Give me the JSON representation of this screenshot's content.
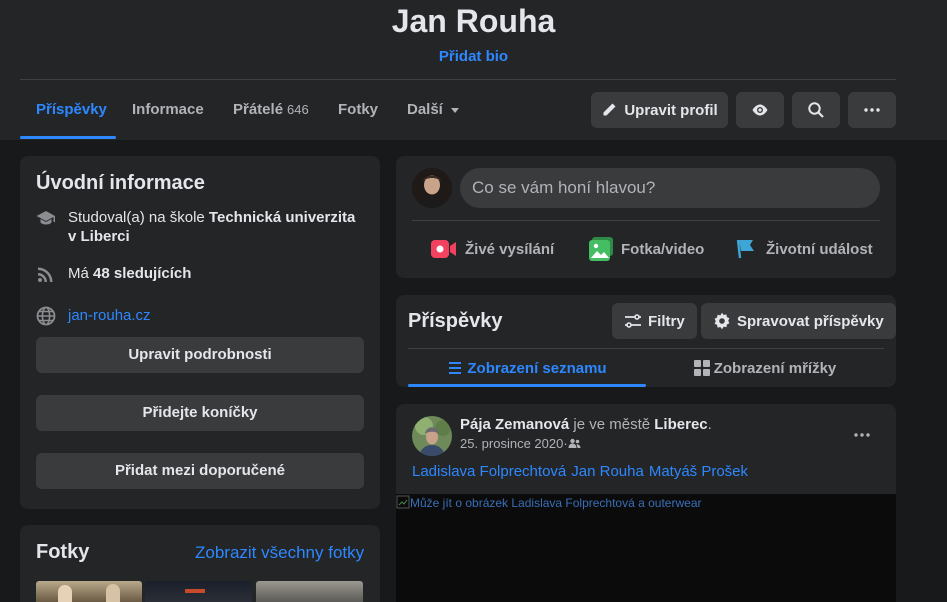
{
  "profile": {
    "name": "Jan Rouha",
    "add_bio": "Přidat bio"
  },
  "tabs": [
    {
      "label": "Příspěvky"
    },
    {
      "label": "Informace"
    },
    {
      "label": "Přátelé",
      "count": "646"
    },
    {
      "label": "Fotky"
    },
    {
      "label": "Další"
    }
  ],
  "header_actions": {
    "edit_profile": "Upravit profil"
  },
  "intro": {
    "title": "Úvodní informace",
    "education_prefix": "Studoval(a) na škole ",
    "education_school": "Technická univerzita v Liberci",
    "followers_prefix": "Má ",
    "followers_value": "48 sledujících",
    "website": "jan-rouha.cz",
    "buttons": [
      "Upravit podrobnosti",
      "Přidejte koníčky",
      "Přidat mezi doporučené"
    ]
  },
  "photos": {
    "title": "Fotky",
    "see_all": "Zobrazit všechny fotky"
  },
  "composer": {
    "placeholder": "Co se vám honí hlavou?",
    "actions": [
      "Živé vysílání",
      "Fotka/video",
      "Životní událost"
    ]
  },
  "posts_section": {
    "title": "Příspěvky",
    "filters": "Filtry",
    "manage": "Spravovat příspěvky",
    "view_list": "Zobrazení seznamu",
    "view_grid": "Zobrazení mřížky"
  },
  "post": {
    "author": "Pája Zemanová",
    "verb": " je ve městě ",
    "place": "Liberec",
    "place_suffix": ".",
    "date": "25. prosince 2020",
    "date_sep": " · ",
    "tags": [
      "Ladislava Folprechtová",
      "Jan Rouha",
      "Matyáš Prošek"
    ],
    "image_alt": "Může jít o obrázek Ladislava Folprechtová a outerwear"
  },
  "colors": {
    "accent": "#2d88ff",
    "bg": "#18191a",
    "card": "#242526",
    "button": "#3a3b3c",
    "live": "#f3425f",
    "photo": "#45bd62",
    "event": "#3ea6d6"
  },
  "icons": [
    "pencil-icon",
    "eye-icon",
    "search-icon",
    "more-icon",
    "graduation-cap-icon",
    "feed-icon",
    "globe-icon",
    "live-video-icon",
    "photo-icon",
    "flag-icon",
    "filter-icon",
    "gear-icon",
    "list-icon",
    "grid-icon",
    "friends-icon"
  ]
}
